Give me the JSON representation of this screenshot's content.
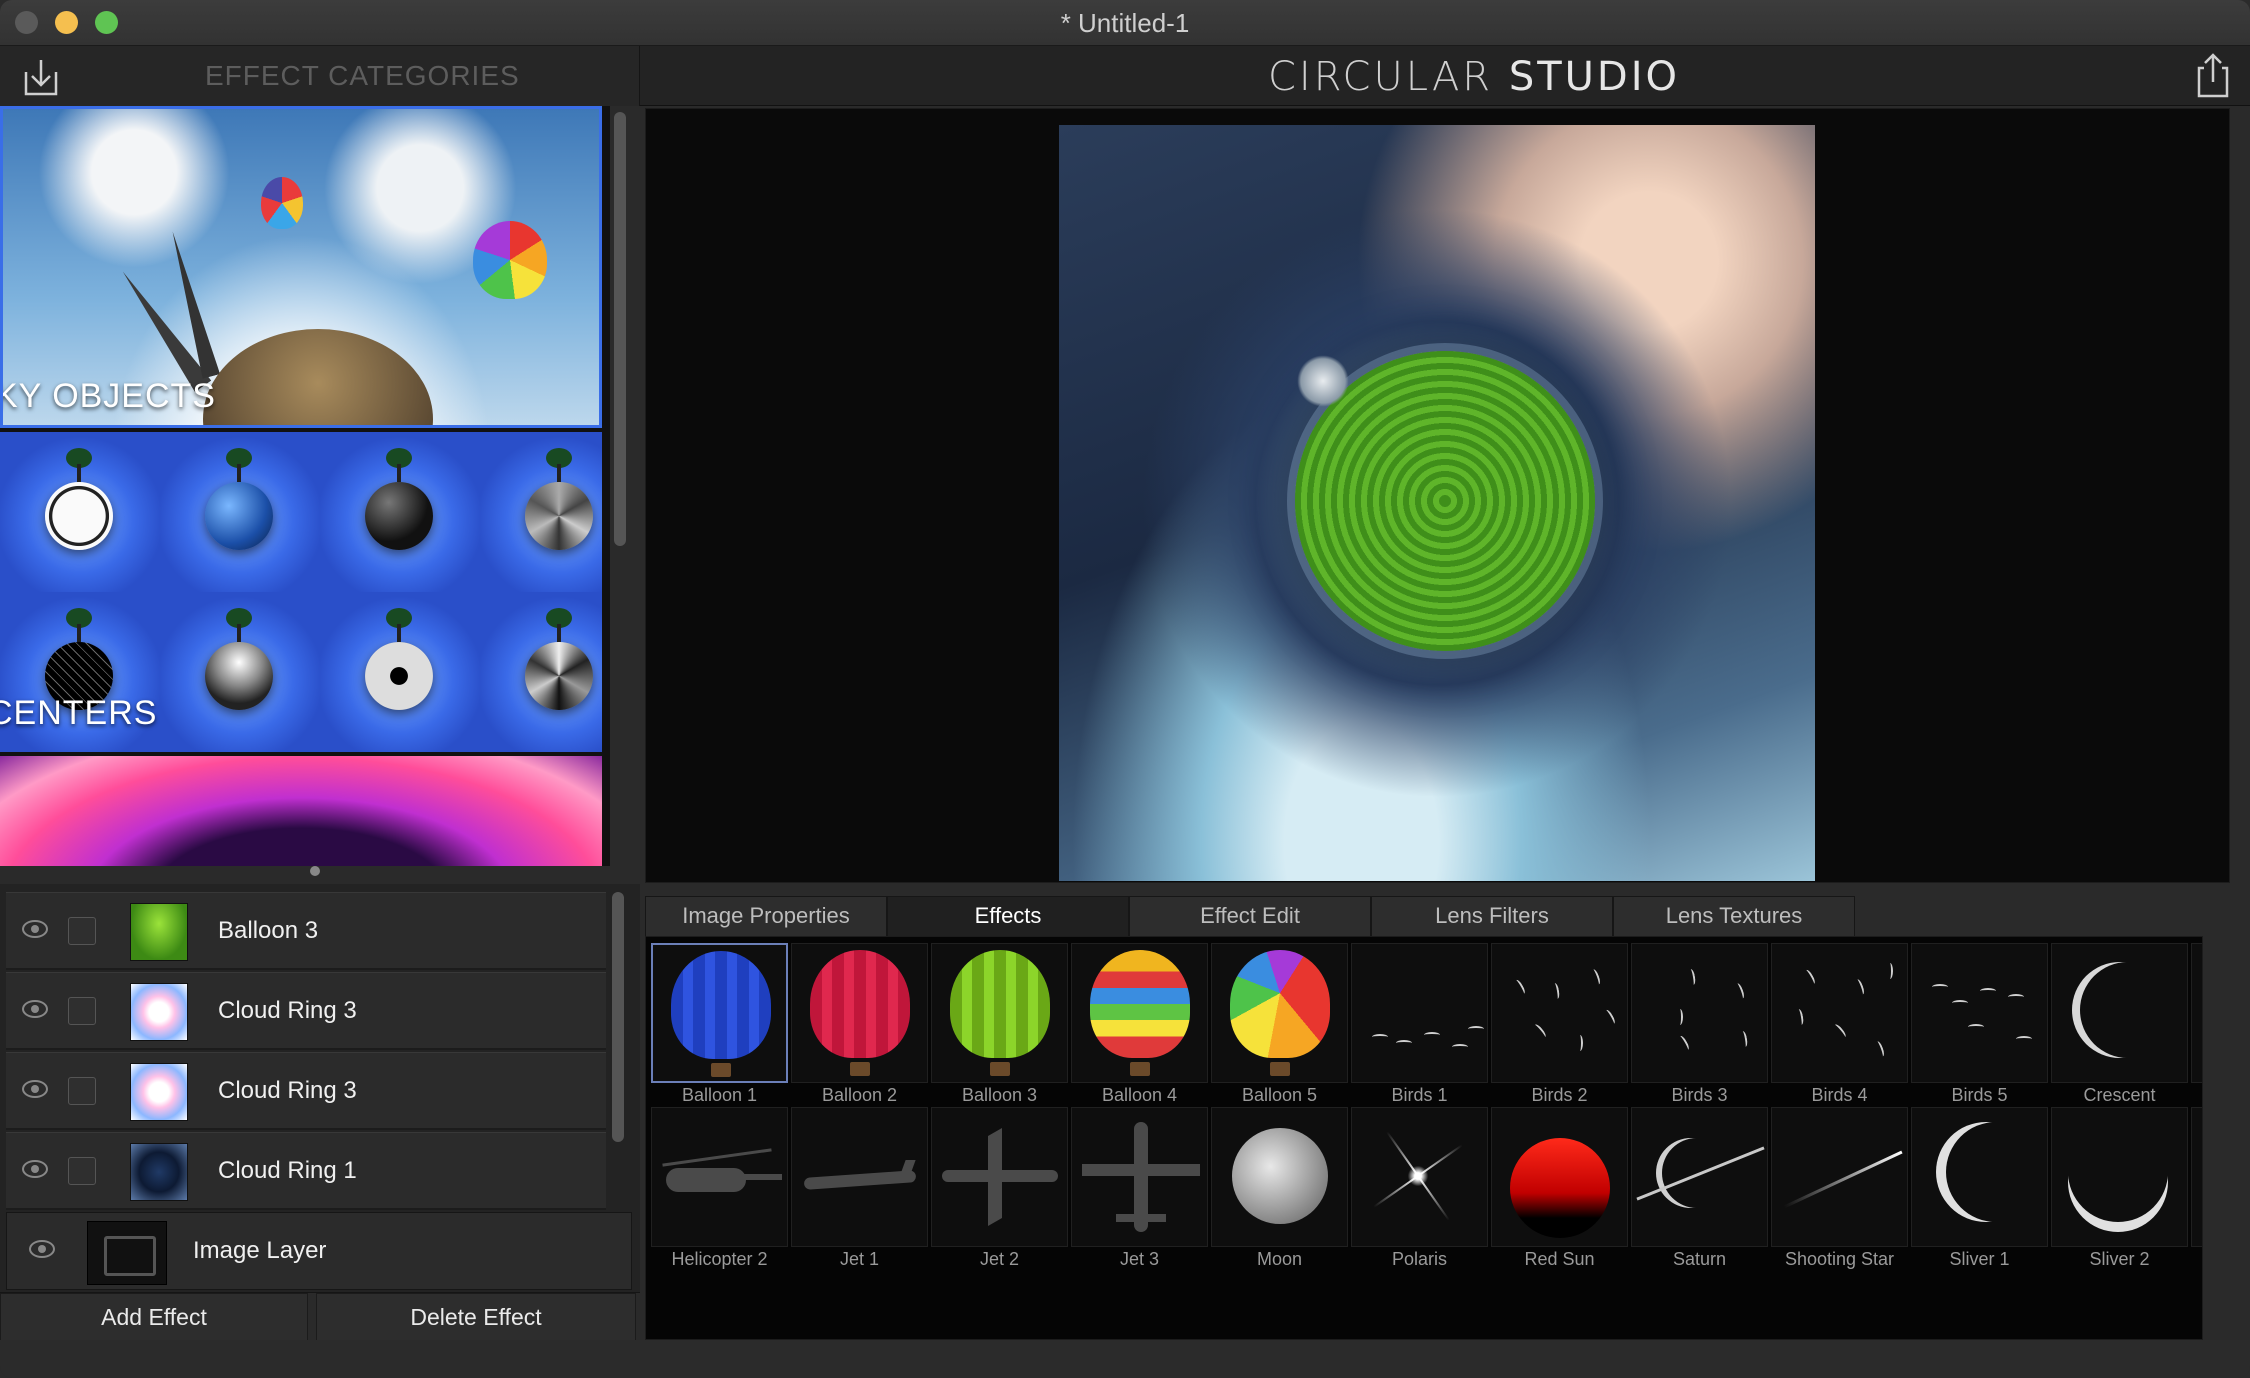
{
  "window": {
    "title": "* Untitled-1"
  },
  "header": {
    "categories_title": "EFFECT CATEGORIES",
    "brand_left": "CIRCULAR",
    "brand_right": "STUDIO"
  },
  "categories": [
    {
      "label": "KY OBJECTS"
    },
    {
      "label": "CENTERS"
    },
    {
      "label": ""
    }
  ],
  "layers": [
    {
      "name": "Balloon 3",
      "thumb": "balloon-green"
    },
    {
      "name": "Cloud Ring 3",
      "thumb": "cloud-ring"
    },
    {
      "name": "Cloud Ring 3",
      "thumb": "cloud-ring"
    },
    {
      "name": "Cloud Ring 1",
      "thumb": "cloud-ring-dark"
    }
  ],
  "image_layer": {
    "name": "Image Layer"
  },
  "buttons": {
    "add": "Add Effect",
    "delete": "Delete Effect"
  },
  "tabs": [
    {
      "label": "Image Properties",
      "active": false
    },
    {
      "label": "Effects",
      "active": true
    },
    {
      "label": "Effect Edit",
      "active": false
    },
    {
      "label": "Lens Filters",
      "active": false
    },
    {
      "label": "Lens Textures",
      "active": false
    }
  ],
  "effects_row1": [
    "Balloon 1",
    "Balloon 2",
    "Balloon 3",
    "Balloon 4",
    "Balloon 5",
    "Birds 1",
    "Birds 2",
    "Birds 3",
    "Birds 4",
    "Birds 5",
    "Crescent"
  ],
  "effects_row2": [
    "Helicopter 2",
    "Jet 1",
    "Jet 2",
    "Jet 3",
    "Moon",
    "Polaris",
    "Red Sun",
    "Saturn",
    "Shooting Star",
    "Sliver 1",
    "Sliver 2"
  ],
  "selected_effect": "Balloon 1",
  "colors": {
    "accent": "#3a6ee8",
    "panel": "#2b2b2b",
    "canvas": "#0a0a0a"
  }
}
